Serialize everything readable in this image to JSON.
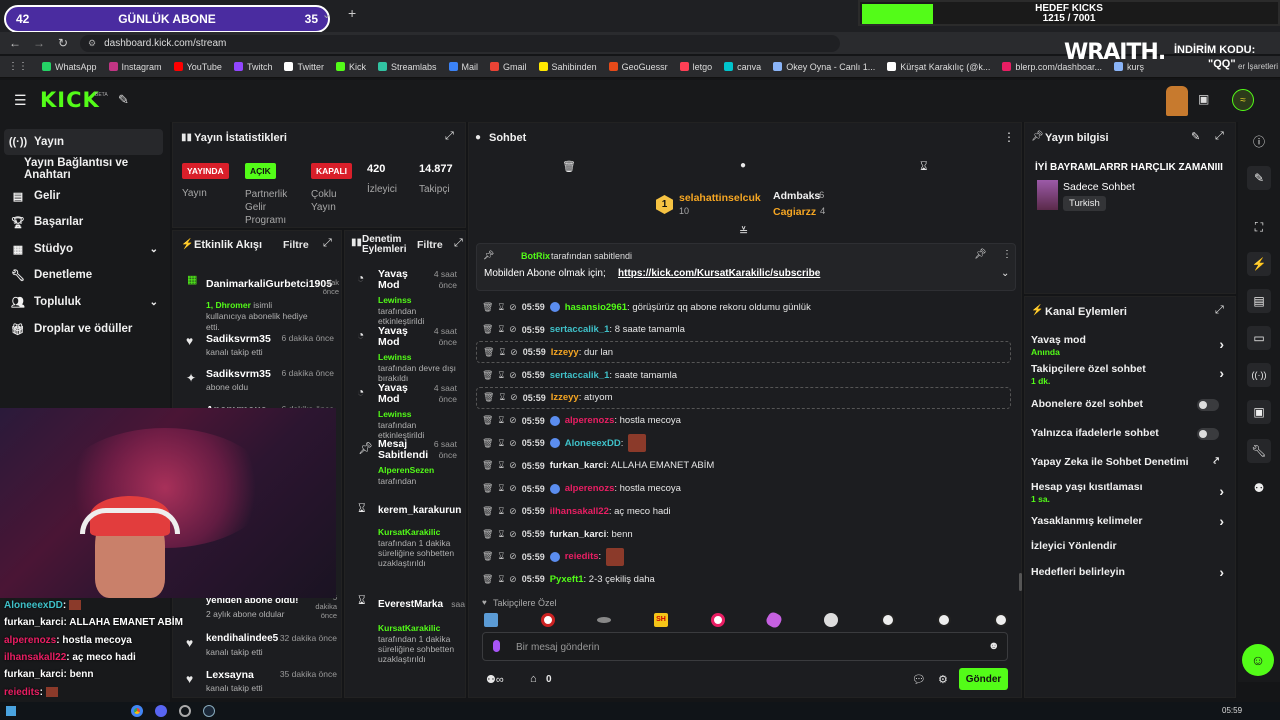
{
  "browser": {
    "overlay_sub_count": "42",
    "overlay_sub_label": "GÜNLÜK ABONE",
    "overlay_sub_goal": "35",
    "url": "dashboard.kick.com/stream",
    "bookmarks": [
      {
        "label": "WhatsApp",
        "color": "#25d366"
      },
      {
        "label": "Instagram",
        "color": "#c13584"
      },
      {
        "label": "YouTube",
        "color": "#ff0000"
      },
      {
        "label": "Twitch",
        "color": "#9146ff"
      },
      {
        "label": "Twitter",
        "color": "#ffffff"
      },
      {
        "label": "Kick",
        "color": "#53fc18"
      },
      {
        "label": "Streamlabs",
        "color": "#31c3a2"
      },
      {
        "label": "Mail",
        "color": "#3b82f6"
      },
      {
        "label": "Gmail",
        "color": "#ea4335"
      },
      {
        "label": "Sahibinden",
        "color": "#ffe800"
      },
      {
        "label": "GeoGuessr",
        "color": "#e64a19"
      },
      {
        "label": "letgo",
        "color": "#ff3f55"
      },
      {
        "label": "canva",
        "color": "#00c4cc"
      },
      {
        "label": "Okey Oyna - Canlı 1...",
        "color": "#8ab4f8"
      },
      {
        "label": "Kürşat Karakılıç (@k...",
        "color": "#ffffff"
      },
      {
        "label": "blerp.com/dashboar...",
        "color": "#e91e63"
      },
      {
        "label": "kurş",
        "color": "#8ab4f8"
      }
    ],
    "bookmarks_other": "er İşaretleri",
    "goal_title": "HEDEF KICKS",
    "goal_value": "1215 / 7001",
    "goal_progress": 0.17,
    "sponsor_name": "WRAITH.",
    "sponsor_code_label": "İNDİRİM KODU:",
    "sponsor_code": "\"QQ\""
  },
  "header": {
    "logo": "KICK",
    "beta": "BETA"
  },
  "sidebar": {
    "items": [
      {
        "label": "Yayın",
        "icon": "broadcast-icon"
      },
      {
        "label": "Yayın Bağlantısı ve Anahtarı",
        "icon": ""
      },
      {
        "label": "Gelir",
        "icon": "wallet-icon"
      },
      {
        "label": "Başarılar",
        "icon": "trophy-icon"
      },
      {
        "label": "Stüdyo",
        "icon": "studio-icon"
      },
      {
        "label": "Denetleme",
        "icon": "wrench-icon"
      },
      {
        "label": "Topluluk",
        "icon": "community-icon"
      },
      {
        "label": "Droplar ve ödüller",
        "icon": "gift-icon"
      }
    ]
  },
  "stats": {
    "title": "Yayın İstatistikleri",
    "live_badge": "YAYINDA",
    "live_label": "Yayın",
    "partner_badge": "AÇIK",
    "partner_label": "Partnerlik Gelir Programı",
    "multi_badge": "KAPALI",
    "multi_label": "Çoklu Yayın",
    "viewers": "420",
    "viewers_label": "İzleyici",
    "followers": "14.877",
    "followers_label": "Takipçi"
  },
  "activity": {
    "title": "Etkinlik Akışı",
    "filter": "Filtre",
    "items": [
      {
        "name": "DanimarkaliGurbetci1905",
        "sub_user": "1, Dhromer",
        "sub": " isimli kullanıcıya abonelik hediye etti.",
        "time": "dak önce"
      },
      {
        "name": "Sadiksvrm35",
        "sub_user": "",
        "sub": "kanalı takip etti",
        "time": "6 dakika önce"
      },
      {
        "name": "Sadiksvrm35",
        "sub_user": "",
        "sub": "abone oldu",
        "time": "6 dakika önce"
      },
      {
        "name": "Anonymous",
        "sub_user": "",
        "sub": "",
        "time": "6 dakika önce"
      },
      {
        "name": "yeniden abone oldu!",
        "sub_user": "",
        "sub": "2 aylık abone oldular",
        "time": "5 dakika önce"
      },
      {
        "name": "kendihalindee5",
        "sub_user": "",
        "sub": "kanalı takip etti",
        "time": "32 dakika önce"
      },
      {
        "name": "Lexsayna",
        "sub_user": "",
        "sub": "kanalı takip etti",
        "time": "35 dakika önce"
      }
    ]
  },
  "modlog": {
    "title": "Denetim Eylemleri",
    "filter": "Filtre",
    "items": [
      {
        "title": "Yavaş Mod",
        "user": "Lewinss",
        "desc": "tarafından etkinleştirildi",
        "time": "4 saat önce"
      },
      {
        "title": "Yavaş Mod",
        "user": "Lewinss",
        "desc": "tarafından devre dışı bırakıldı",
        "time": "4 saat önce"
      },
      {
        "title": "Yavaş Mod",
        "user": "Lewinss",
        "desc": "tarafından etkinleştirildi",
        "time": "4 saat önce"
      },
      {
        "title": "Mesaj Sabitlendi",
        "user": "AlperenSezen",
        "desc": "tarafından",
        "time": "6 saat önce"
      },
      {
        "title": "kerem_karakurun",
        "user": "KursatKarakilic",
        "desc": "tarafından 1 dakika süreliğine sohbetten uzaklaştırıldı",
        "time": ""
      },
      {
        "title": "EverestMarka",
        "user": "KursatKarakilic",
        "desc": "tarafından 1 dakika süreliğine sohbetten uzaklaştırıldı",
        "time": "saa"
      }
    ]
  },
  "chat": {
    "title": "Sohbet",
    "leaders": [
      {
        "name": "selahattinselcuk",
        "count": "10"
      },
      {
        "name": "Admbaks",
        "count": "6"
      },
      {
        "name": "Cagiarzz",
        "count": "4"
      }
    ],
    "pinned_by_user": "BotRix",
    "pinned_by_suffix": " tarafından sabitlendi",
    "pinned_text": "Mobilden Abone olmak için; ",
    "pinned_link": "https://kick.com/KursatKarakilic/subscribe",
    "messages": [
      {
        "time": "05:59",
        "user": "hasansio2961",
        "color": "#53fc18",
        "text": ": görüşürüz qq abone rekoru oldumu günlük",
        "emote": false,
        "badge": true
      },
      {
        "time": "05:59",
        "user": "sertaccalik_1",
        "color": "#3fc1c9",
        "text": ": 8 saate tamamla",
        "emote": false,
        "badge": false
      },
      {
        "time": "05:59",
        "user": "Izzeyy",
        "color": "#f5a623",
        "text": ": dur lan",
        "emote": false,
        "badge": false
      },
      {
        "time": "05:59",
        "user": "sertaccalik_1",
        "color": "#3fc1c9",
        "text": ": saate tamamla",
        "emote": false,
        "badge": false
      },
      {
        "time": "05:59",
        "user": "Izzeyy",
        "color": "#f5a623",
        "text": ": atıyom",
        "emote": false,
        "badge": false
      },
      {
        "time": "05:59",
        "user": "alperenozs",
        "color": "#e91e63",
        "text": ": hostla mecoya",
        "emote": false,
        "badge": true
      },
      {
        "time": "05:59",
        "user": "AloneeexDD",
        "color": "#3fc1c9",
        "text": ": ",
        "emote": true,
        "badge": true
      },
      {
        "time": "05:59",
        "user": "furkan_karci",
        "color": "#f0f0f0",
        "text": ": ALLAHA EMANET ABİM",
        "emote": false,
        "badge": false
      },
      {
        "time": "05:59",
        "user": "alperenozs",
        "color": "#e91e63",
        "text": ": hostla mecoya",
        "emote": false,
        "badge": true
      },
      {
        "time": "05:59",
        "user": "ilhansakall22",
        "color": "#e91e63",
        "text": ": aç meco hadi",
        "emote": false,
        "badge": false
      },
      {
        "time": "05:59",
        "user": "furkan_karci",
        "color": "#f0f0f0",
        "text": ": benn",
        "emote": false,
        "badge": false
      },
      {
        "time": "05:59",
        "user": "reiedits",
        "color": "#e91e63",
        "text": ": ",
        "emote": true,
        "badge": true
      },
      {
        "time": "05:59",
        "user": "Pyxeft1",
        "color": "#53fc18",
        "text": ": 2-3 çekiliş daha",
        "emote": false,
        "badge": false
      }
    ],
    "followers_only": "Takipçilere Özel",
    "input_placeholder": "Bir mesaj gönderin",
    "points": "0",
    "send": "Gönder"
  },
  "stream_info": {
    "title": "Yayın bilgisi",
    "stream_title": "İYİ BAYRAMLARRR HARÇLIK ZAMANIII",
    "category": "Sadece Sohbet",
    "language": "Turkish"
  },
  "channel_actions": {
    "title": "Kanal Eylemleri",
    "items": [
      {
        "label": "Yavaş mod",
        "sub": "Anında",
        "control": "chevron"
      },
      {
        "label": "Takipçilere özel sohbet",
        "sub": "1 dk.",
        "control": "chevron"
      },
      {
        "label": "Abonelere özel sohbet",
        "sub": "",
        "control": "toggle"
      },
      {
        "label": "Yalnızca ifadelerle sohbet",
        "sub": "",
        "control": "toggle"
      },
      {
        "label": "Yapay Zeka ile Sohbet Denetimi",
        "sub": "",
        "control": "external"
      },
      {
        "label": "Hesap yaşı kısıtlaması",
        "sub": "1 sa.",
        "control": "chevron"
      },
      {
        "label": "Yasaklanmış kelimeler",
        "sub": "",
        "control": "chevron"
      },
      {
        "label": "İzleyici Yönlendir",
        "sub": "",
        "control": "none"
      },
      {
        "label": "Hedefleri belirleyin",
        "sub": "",
        "control": "chevron"
      }
    ]
  },
  "overlay_chat": [
    {
      "user": "AloneeexDD",
      "color": "#3fc1c9",
      "text": ":",
      "emote": true
    },
    {
      "user": "furkan_karci",
      "color": "#ffffff",
      "text": ": ALLAHA EMANET ABİM",
      "emote": false
    },
    {
      "user": "alperenozs",
      "color": "#e91e63",
      "text": ": hostla mecoya",
      "emote": false
    },
    {
      "user": "ilhansakall22",
      "color": "#e91e63",
      "text": ": aç meco hadi",
      "emote": false
    },
    {
      "user": "furkan_karci",
      "color": "#ffffff",
      "text": ": benn",
      "emote": false
    },
    {
      "user": "reiedits",
      "color": "#e91e63",
      "text": ":",
      "emote": true
    },
    {
      "user": "Pyxeft1",
      "color": "#53fc18",
      "text": ": 2-3 çekiliş daha",
      "emote": false
    }
  ],
  "taskbar": {
    "clock": "05:59"
  }
}
